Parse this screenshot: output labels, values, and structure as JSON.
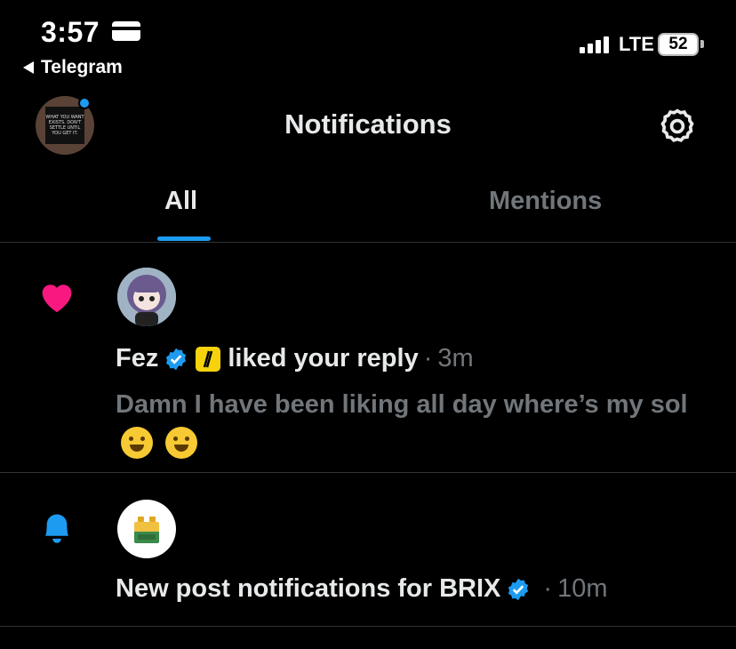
{
  "status_bar": {
    "time": "3:57",
    "back_app": "Telegram",
    "network": "LTE",
    "battery": "52"
  },
  "header": {
    "title": "Notifications",
    "avatar_text": "WHAT YOU WANT EXISTS. DON'T SETTLE UNTIL YOU GET IT."
  },
  "tabs": [
    {
      "label": "All",
      "active": true
    },
    {
      "label": "Mentions",
      "active": false
    }
  ],
  "notifications": [
    {
      "type": "like",
      "icon": "heart-icon",
      "user": "Fez",
      "action": "liked your reply",
      "separator": "·",
      "time": "3m",
      "content": "Damn I have been liking all day where’s my sol"
    },
    {
      "type": "new-post",
      "icon": "bell-icon",
      "text": "New post notifications for BRIX",
      "separator": "·",
      "time": "10m"
    }
  ],
  "colors": {
    "background": "#000000",
    "accent": "#1d9bf0",
    "heart": "#f91880",
    "muted": "#71767b",
    "text": "#e7e9ea"
  }
}
